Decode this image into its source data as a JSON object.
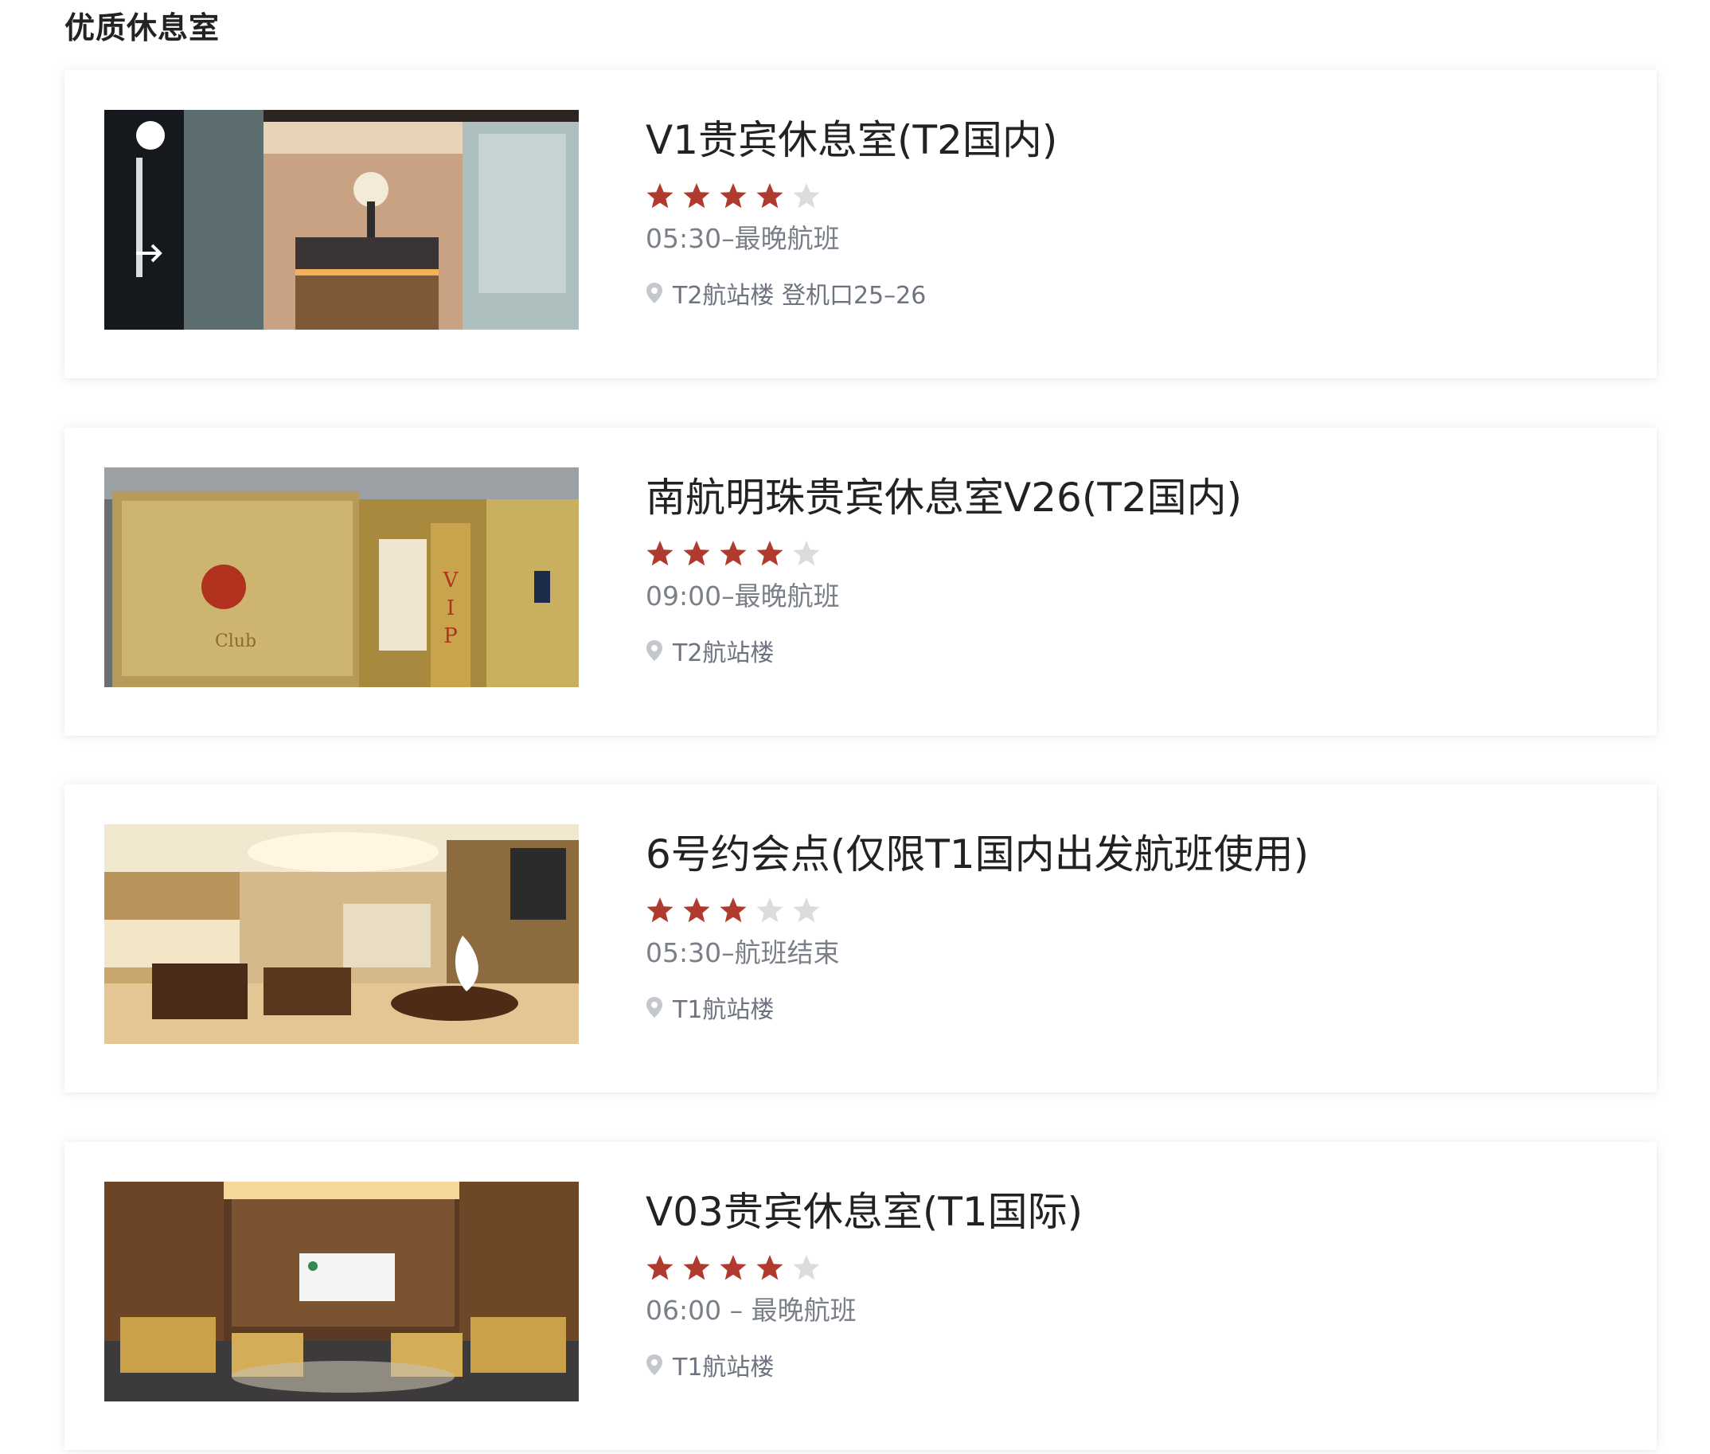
{
  "section": {
    "title": "优质休息室"
  },
  "colors": {
    "star_filled": "#b03a2e",
    "star_empty": "#dcdcdc",
    "text_primary": "#222222",
    "text_secondary": "#7a7f88"
  },
  "lounges": [
    {
      "name": "V1贵宾休息室(T2国内)",
      "rating": 4,
      "max_rating": 5,
      "hours": "05:30–最晚航班",
      "location": "T2航站楼 登机口25–26",
      "location_icon": "map-pin-icon"
    },
    {
      "name": "南航明珠贵宾休息室V26(T2国内)",
      "rating": 4,
      "max_rating": 5,
      "hours": "09:00–最晚航班",
      "location": "T2航站楼",
      "location_icon": "map-pin-icon"
    },
    {
      "name": "6号约会点(仅限T1国内出发航班使用)",
      "rating": 3,
      "max_rating": 5,
      "hours": "05:30–航班结束",
      "location": "T1航站楼",
      "location_icon": "map-pin-icon"
    },
    {
      "name": "V03贵宾休息室(T1国际)",
      "rating": 4,
      "max_rating": 5,
      "hours": "06:00 – 最晚航班",
      "location": "T1航站楼",
      "location_icon": "map-pin-icon"
    }
  ]
}
